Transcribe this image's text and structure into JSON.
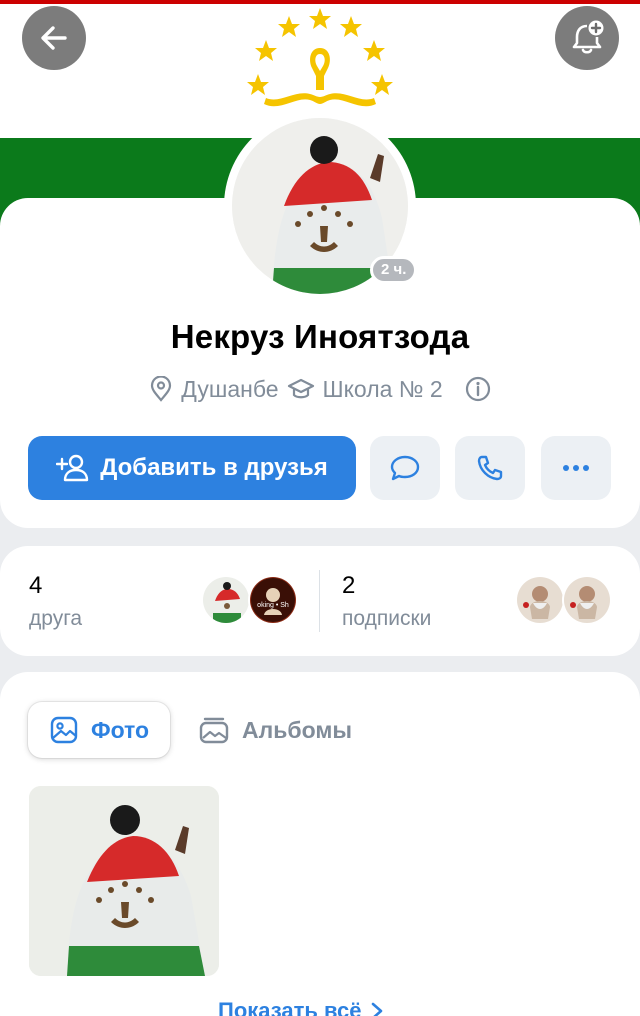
{
  "header": {
    "back_icon": "arrow-left-icon",
    "notify_icon": "bell-plus-icon",
    "flag_colors": {
      "red": "#cc0000",
      "white": "#ffffff",
      "green": "#0b7a1b",
      "gold": "#f5c400"
    }
  },
  "profile": {
    "name": "Некруз Иноятзода",
    "online_badge": "2 ч.",
    "city": "Душанбе",
    "school": "Школа № 2",
    "city_icon": "location-pin-icon",
    "school_icon": "graduation-cap-icon",
    "info_icon": "info-circle-icon"
  },
  "actions": {
    "add_friend_label": "Добавить в друзья",
    "add_friend_icon": "user-plus-icon",
    "message_icon": "message-bubble-icon",
    "call_icon": "phone-icon",
    "more_icon": "more-dots-icon",
    "accent": "#2d81e0"
  },
  "counts": {
    "friends": {
      "value": "4",
      "label": "друга"
    },
    "subscriptions": {
      "value": "2",
      "label": "подписки"
    },
    "friend_avatar_text": "oking • Sh"
  },
  "photos": {
    "tab_photo_label": "Фото",
    "tab_albums_label": "Альбомы",
    "show_all_label": "Показать всё"
  }
}
